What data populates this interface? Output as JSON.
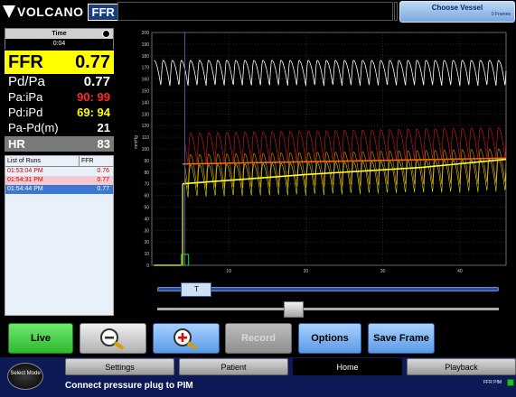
{
  "header": {
    "brand": "VOLCANO",
    "product": "FFR",
    "choose_vessel": "Choose Vessel",
    "frames": "0 Frames"
  },
  "time": {
    "title": "Time",
    "value": "0:04"
  },
  "ffr": {
    "label": "FFR",
    "value": "0.77"
  },
  "metrics": [
    {
      "label": "Pd/Pa",
      "value": "0.77",
      "color": "#ffffff"
    },
    {
      "label": "Pa:iPa",
      "value": "90: 99",
      "color": "#ff2a2a"
    },
    {
      "label": "Pd:iPd",
      "value": "69: 94",
      "color": "#ffff00"
    },
    {
      "label": "Pa-Pd(m)",
      "value": "21",
      "color": "#ffffff"
    },
    {
      "label": "HR",
      "value": "83",
      "color": "#ffffff"
    }
  ],
  "runs": {
    "headers": [
      "List of Runs",
      "FFR"
    ],
    "rows": [
      {
        "time": "01:53:04 PM",
        "ffr": "0.76",
        "bg": "#e8f1fa",
        "color": "#cc0000"
      },
      {
        "time": "01:54:31 PM",
        "ffr": "0.77",
        "bg": "#f5c9d0",
        "color": "#cc0000"
      },
      {
        "time": "01:54:44 PM",
        "ffr": "0.77",
        "bg": "#3a78d4",
        "color": "#ffffff"
      }
    ]
  },
  "chart_data": {
    "type": "line",
    "ylabel": "mmHg",
    "ylim": [
      0,
      200
    ],
    "xlim": [
      0,
      46
    ],
    "yticks": [
      0,
      10,
      20,
      30,
      40,
      50,
      60,
      70,
      80,
      90,
      100,
      110,
      120,
      130,
      140,
      150,
      160,
      170,
      180,
      190,
      200
    ],
    "xticks": [
      10,
      20,
      30,
      40
    ],
    "cursor_x": 4.3,
    "series": [
      {
        "name": "",
        "color": "#ffffff",
        "mean": 165,
        "amplitude": 22,
        "start": 0
      },
      {
        "name": "",
        "color": "#ff2020",
        "mean": 100,
        "amplitude": 27,
        "start": 0
      },
      {
        "name": "",
        "color": "#ffb000",
        "mean": 80,
        "amplitude": 30,
        "start": 0
      },
      {
        "name": "",
        "color": "#ffff00",
        "mean": 72,
        "amplitude": 28,
        "start": 0
      },
      {
        "name": "",
        "color": "#ff6a00",
        "mean_line": [
          [
            4,
            87
          ],
          [
            46,
            92
          ]
        ]
      },
      {
        "name": "",
        "color": "#ffff33",
        "mean_line": [
          [
            4,
            70
          ],
          [
            20,
            78
          ],
          [
            35,
            84
          ],
          [
            46,
            91
          ]
        ]
      }
    ]
  },
  "slider": {
    "marker": "T"
  },
  "buttons": {
    "live": "Live",
    "record": "Record",
    "options": "Options",
    "save": "Save Frame"
  },
  "tabs": [
    "Settings",
    "Patient",
    "Home",
    "Playback"
  ],
  "select_mode": "Select Mode",
  "status": "Connect pressure plug to PIM",
  "pim": "FFR PIM"
}
